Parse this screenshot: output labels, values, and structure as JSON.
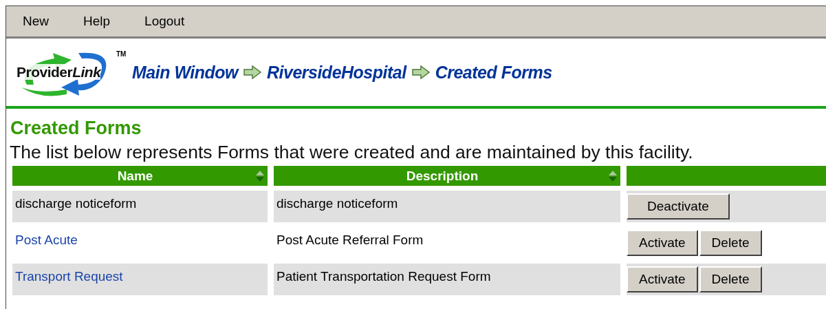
{
  "menu": [
    "New",
    "Help",
    "Logout"
  ],
  "logo": {
    "text": "Provider",
    "accent": "Link",
    "mark": "TM"
  },
  "breadcrumb": [
    "Main Window",
    "RiversideHospital",
    "Created Forms"
  ],
  "title": "Created Forms",
  "intro": "The list below represents Forms that were created and are maintained by this facility.",
  "table": {
    "columns": [
      {
        "label": "Name",
        "sortable": true
      },
      {
        "label": "Description",
        "sortable": true
      },
      {}
    ],
    "rows": [
      {
        "name": "discharge noticeform",
        "kind": "text",
        "description": "discharge noticeform",
        "buttons": [
          "Deactivate"
        ]
      },
      {
        "name": "Post Acute",
        "kind": "link",
        "description": "Post Acute Referral Form",
        "buttons": [
          "Activate",
          "Delete"
        ]
      },
      {
        "name": "Transport Request",
        "kind": "link",
        "description": "Patient Transportation Request Form",
        "buttons": [
          "Activate",
          "Delete"
        ]
      }
    ]
  }
}
